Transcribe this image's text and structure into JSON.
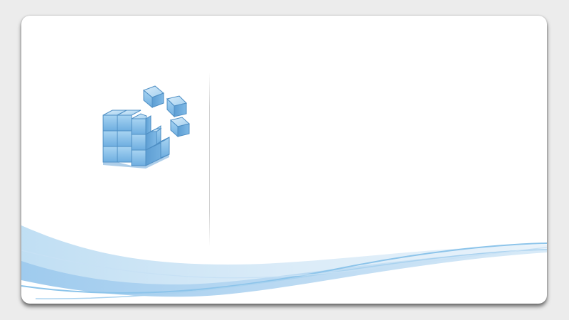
{
  "splash": {
    "colors": {
      "background": "#ececec",
      "card": "#ffffff",
      "wave_light": "#d3e7f5",
      "wave_mid": "#a8d0ee",
      "wave_accent": "#7fbbe6",
      "cube_face": "#8cc3ea",
      "cube_edge": "#5a9ccc"
    },
    "icons": {
      "logo": "registry-cubes-icon"
    }
  }
}
